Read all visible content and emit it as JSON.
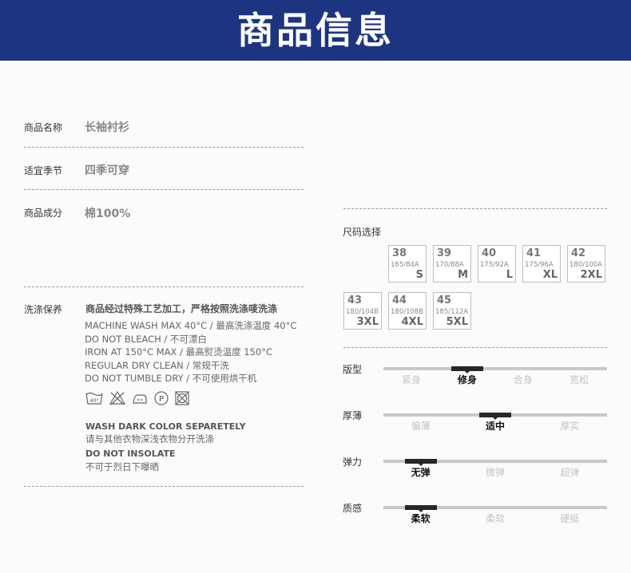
{
  "header": {
    "title": "商品信息"
  },
  "info": {
    "name_label": "商品名称",
    "name_value": "长袖衬衫",
    "season_label": "适宜季节",
    "season_value": "四季可穿",
    "material_label": "商品成分",
    "material_value": "棉100%"
  },
  "care": {
    "label": "洗涤保养",
    "title": "商品经过特殊工艺加工，严格按照洗涤唛洗涤",
    "lines": [
      "MACHINE WASH MAX 40°C / 最高洗涤温度 40°C",
      "DO NOT BLEACH / 不可漂白",
      "IRON AT 150°C MAX / 最高熨烫温度 150°C",
      "REGULAR DRY CLEAN / 常规干洗",
      "DO NOT TUMBLE DRY / 不可使用烘干机"
    ],
    "icons": [
      "wash-40-icon",
      "no-bleach-icon",
      "iron-icon",
      "dry-clean-p-icon",
      "no-tumble-dry-icon"
    ],
    "wash_icon_text": "40°",
    "dryclean_icon_text": "P",
    "note1_en": "WASH DARK COLOR SEPARETELY",
    "note1_cn": "请与其他衣物深浅衣物分开洗涤",
    "note2_en": "DO NOT INSOLATE",
    "note2_cn": "不可于烈日下曝晒"
  },
  "sizes": {
    "label": "尺码选择",
    "items": [
      {
        "num": "38",
        "spec": "165/84A",
        "letter": "S"
      },
      {
        "num": "39",
        "spec": "170/88A",
        "letter": "M"
      },
      {
        "num": "40",
        "spec": "175/92A",
        "letter": "L"
      },
      {
        "num": "41",
        "spec": "175/96A",
        "letter": "XL"
      },
      {
        "num": "42",
        "spec": "180/100A",
        "letter": "2XL"
      },
      {
        "num": "43",
        "spec": "180/104B",
        "letter": "3XL"
      },
      {
        "num": "44",
        "spec": "180/108B",
        "letter": "4XL"
      },
      {
        "num": "45",
        "spec": "185/112A",
        "letter": "5XL"
      }
    ]
  },
  "attributes": [
    {
      "label": "版型",
      "options": [
        "紧身",
        "修身",
        "合身",
        "宽松"
      ],
      "selected": 1
    },
    {
      "label": "厚薄",
      "options": [
        "偏薄",
        "适中",
        "厚实"
      ],
      "selected": 1
    },
    {
      "label": "弹力",
      "options": [
        "无弹",
        "微弹",
        "超弹"
      ],
      "selected": 0
    },
    {
      "label": "质感",
      "options": [
        "柔软",
        "柔软",
        "硬挺"
      ],
      "selected": 0
    }
  ],
  "colors": {
    "header_bg": "#1d3580",
    "marker": "#262626",
    "track": "#c8c8c8"
  }
}
